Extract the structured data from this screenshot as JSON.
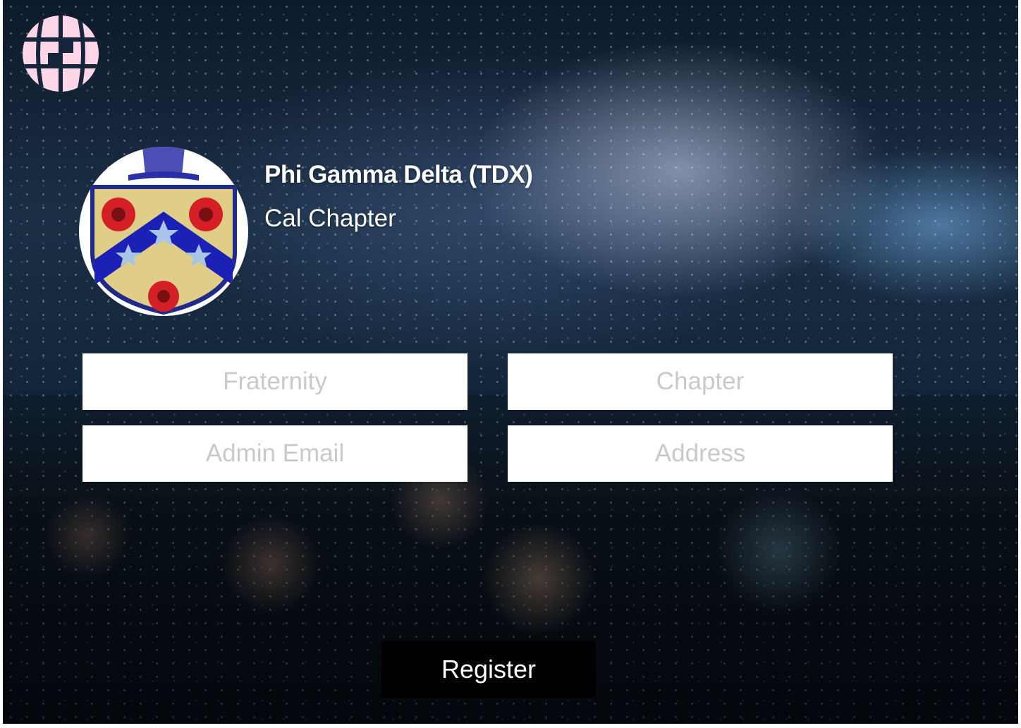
{
  "app": {
    "logo_icon": "globe-grid-icon",
    "logo_color": "#FFD6E8"
  },
  "profile": {
    "crest_icon": "fraternity-crest-icon",
    "fraternity_name": "Phi Gamma Delta (TDX)",
    "chapter_name": "Cal Chapter"
  },
  "form": {
    "fraternity_placeholder": "Fraternity",
    "chapter_placeholder": "Chapter",
    "admin_email_placeholder": "Admin Email",
    "address_placeholder": "Address",
    "register_label": "Register"
  },
  "colors": {
    "button_bg": "#000000",
    "button_text": "#FFFFFF",
    "field_bg": "#FFFFFF",
    "placeholder": "#C9C9C9"
  }
}
